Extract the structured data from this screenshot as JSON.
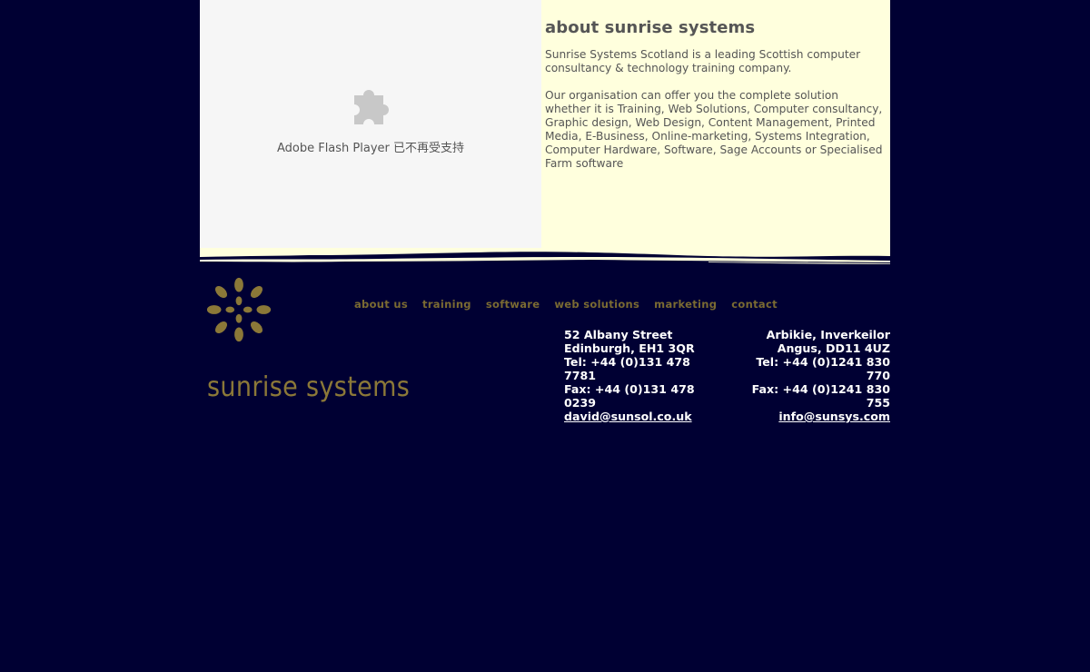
{
  "flash": {
    "message": "Adobe Flash Player 已不再受支持",
    "icon": "puzzle-piece-icon"
  },
  "about": {
    "title": "about sunrise systems",
    "paragraph1": "Sunrise Systems Scotland is a leading Scottish computer consultancy & technology training company.",
    "paragraph2": "Our organisation can offer you the complete solution whether it is Training, Web Solutions, Computer consultancy, Graphic design, Web Design, Content Management, Printed Media, E-Business, Online-marketing, Systems Integration, Computer Hardware, Software, Sage Accounts or Specialised Farm software"
  },
  "logo": {
    "text": "sunrise systems",
    "icon": "sun-logo-icon"
  },
  "nav": {
    "items": [
      "about us",
      "training",
      "software",
      "web solutions",
      "marketing",
      "contact"
    ]
  },
  "addresses": {
    "edinburgh": {
      "line1": "52 Albany Street",
      "line2": "Edinburgh, EH1 3QR",
      "tel": "Tel: +44 (0)131 478 7781",
      "fax": "Fax: +44 (0)131 478 0239",
      "email": "david@sunsol.co.uk"
    },
    "angus": {
      "line1": "Arbikie, Inverkeilor",
      "line2": "Angus, DD11 4UZ",
      "tel": "Tel: +44 (0)1241 830 770",
      "fax": "Fax: +44 (0)1241 830 755",
      "email": "info@sunsys.com"
    }
  },
  "colors": {
    "background": "#000033",
    "about_panel": "#ffffdd",
    "flash_panel": "#f6f6f6",
    "logo_gold": "#8b7838",
    "nav_gold": "#7a6a32",
    "text_gray": "#555555"
  }
}
